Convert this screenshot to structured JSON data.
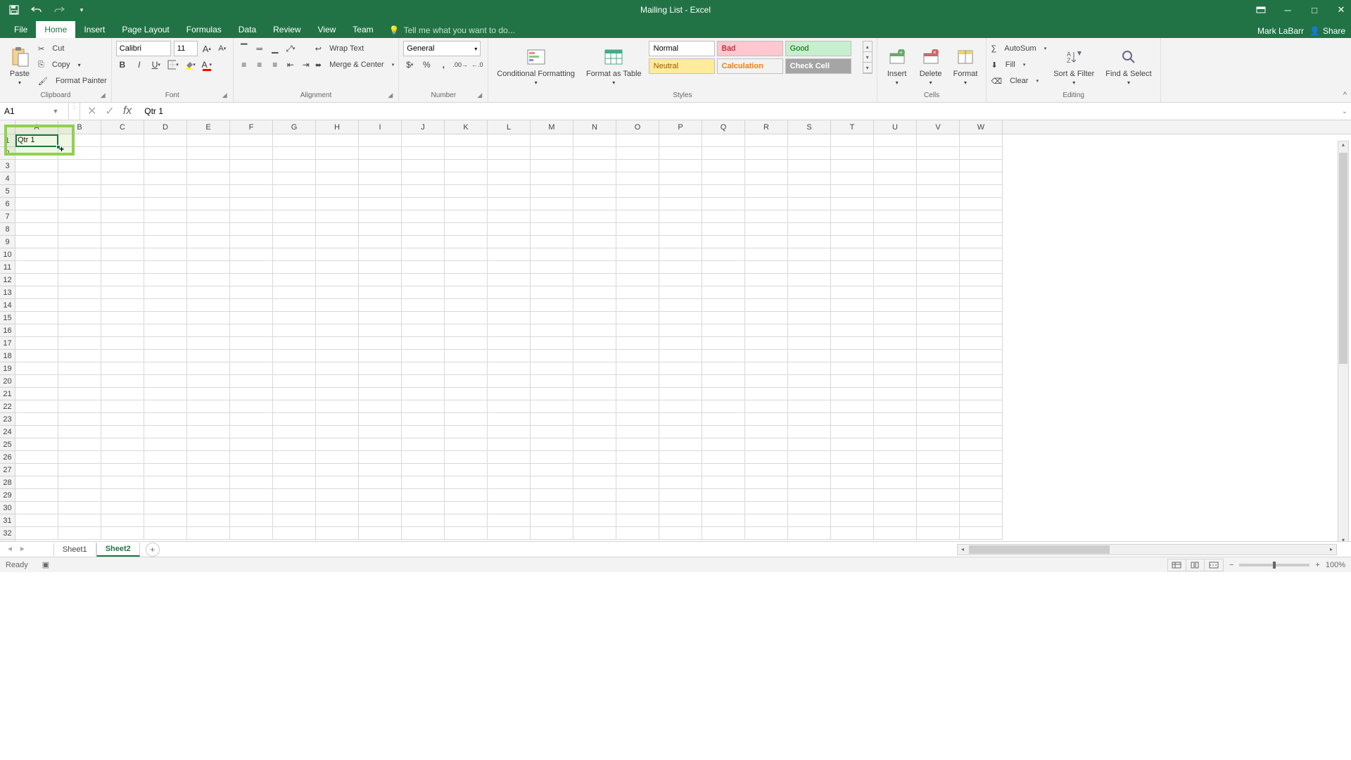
{
  "app_title": "Mailing List - Excel",
  "user_name": "Mark LaBarr",
  "share_label": "Share",
  "tabs": [
    "File",
    "Home",
    "Insert",
    "Page Layout",
    "Formulas",
    "Data",
    "Review",
    "View",
    "Team"
  ],
  "active_tab": "Home",
  "tellme_placeholder": "Tell me what you want to do...",
  "clipboard": {
    "paste": "Paste",
    "cut": "Cut",
    "copy": "Copy",
    "painter": "Format Painter",
    "label": "Clipboard"
  },
  "font": {
    "name": "Calibri",
    "size": "11",
    "label": "Font"
  },
  "alignment": {
    "wrap": "Wrap Text",
    "merge": "Merge & Center",
    "label": "Alignment"
  },
  "number": {
    "format": "General",
    "label": "Number"
  },
  "styles": {
    "cond": "Conditional Formatting",
    "table": "Format as Table",
    "items": [
      "Normal",
      "Bad",
      "Good",
      "Neutral",
      "Calculation",
      "Check Cell"
    ],
    "label": "Styles"
  },
  "cells": {
    "insert": "Insert",
    "delete": "Delete",
    "format": "Format",
    "label": "Cells"
  },
  "editing": {
    "autosum": "AutoSum",
    "fill": "Fill",
    "clear": "Clear",
    "sort": "Sort & Filter",
    "find": "Find & Select",
    "label": "Editing"
  },
  "name_box": "A1",
  "formula_value": "Qtr 1",
  "columns": [
    "A",
    "B",
    "C",
    "D",
    "E",
    "F",
    "G",
    "H",
    "I",
    "J",
    "K",
    "L",
    "M",
    "N",
    "O",
    "P",
    "Q",
    "R",
    "S",
    "T",
    "U",
    "V",
    "W"
  ],
  "rows": [
    "1",
    "2",
    "3",
    "4",
    "5",
    "6",
    "7",
    "8",
    "9",
    "10",
    "11",
    "12",
    "13",
    "14",
    "15",
    "16",
    "17",
    "18",
    "19",
    "20",
    "21",
    "22",
    "23",
    "24",
    "25",
    "26",
    "27",
    "28",
    "29",
    "30",
    "31",
    "32"
  ],
  "cell_a1": "Qtr 1",
  "sheets": [
    "Sheet1",
    "Sheet2"
  ],
  "active_sheet": "Sheet2",
  "status": "Ready",
  "zoom": "100%"
}
